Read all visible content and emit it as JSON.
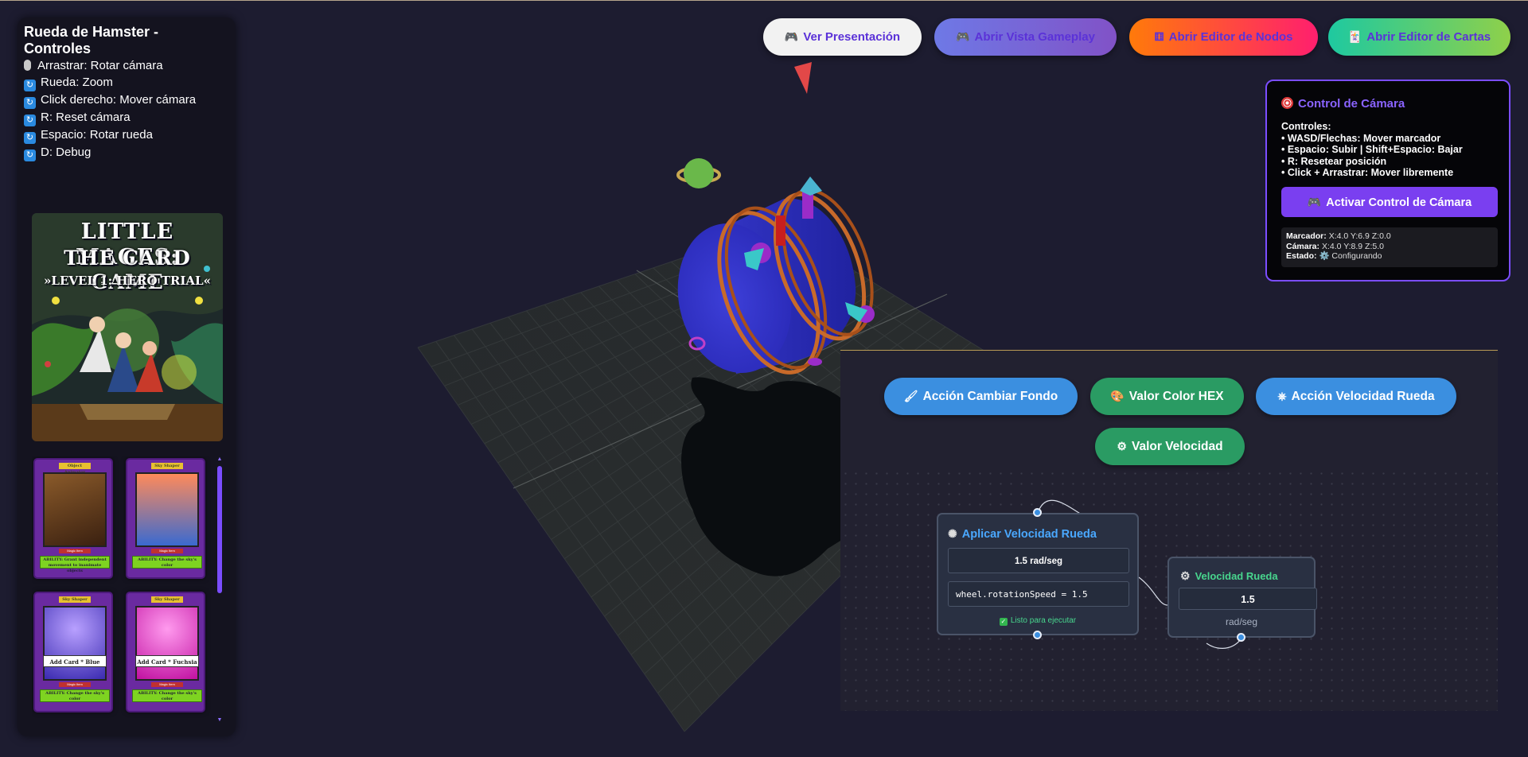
{
  "controls": {
    "title": "Rueda de Hamster - Controles",
    "lines": [
      "Arrastrar: Rotar cámara",
      "Rueda: Zoom",
      "Click derecho: Mover cámara",
      "R: Reset cámara",
      "Espacio: Rotar rueda",
      "D: Debug"
    ]
  },
  "card_art": {
    "title1": "LITTLE MAGES:",
    "title2": "THE CARD GAME",
    "title3": "»LEVEL 1: HERO TRIAL«"
  },
  "mini_cards": [
    {
      "name": "Object Animator",
      "type": "Magic Item",
      "ability": "ABILITY: Grant independent movement to inanimate objects",
      "colors": [
        "#8a5a2a",
        "#3a2010"
      ]
    },
    {
      "name": "Sky Shaper",
      "type": "Magic Item",
      "ability": "ABILITY: Change the sky's color",
      "colors": [
        "#ff8a5a",
        "#3a6ad0"
      ]
    },
    {
      "name": "Sky Shaper",
      "type": "Magic Item",
      "ability": "ABILITY: Change the sky's color",
      "banner": "Add Card * Blue",
      "colors": [
        "#b8a0ff",
        "#3a2ab0"
      ]
    },
    {
      "name": "Sky Shaper",
      "type": "Magic Item",
      "ability": "ABILITY: Change the sky's color",
      "banner": "Add Card * Fuchsia",
      "colors": [
        "#ff9aee",
        "#c010a0"
      ]
    }
  ],
  "top_buttons": {
    "present": "Ver Presentación",
    "gameplay": "Abrir Vista Gameplay",
    "nodes": "Abrir Editor de Nodos",
    "cards": "Abrir Editor de Cartas"
  },
  "camera_panel": {
    "title": "Control de Cámara",
    "controls_label": "Controles:",
    "lines": [
      "• WASD/Flechas: Mover marcador",
      "• Espacio: Subir | Shift+Espacio: Bajar",
      "• R: Resetear posición",
      "• Click + Arrastrar: Mover libremente"
    ],
    "activate": "Activar Control de Cámara",
    "marker_label": "Marcador:",
    "marker_value": "X:4.0 Y:6.9 Z:0.0",
    "camera_label": "Cámara:",
    "camera_value": "X:4.0 Y:8.9 Z:5.0",
    "state_label": "Estado:",
    "state_value": "⚙️ Configurando"
  },
  "node_palette": {
    "bg": "Acción Cambiar Fondo",
    "hex": "Valor Color HEX",
    "speed_action": "Acción Velocidad Rueda",
    "speed_value": "Valor Velocidad"
  },
  "node_apply": {
    "title": "Aplicar Velocidad Rueda",
    "speed": "1.5 rad/seg",
    "code": "wheel.rotationSpeed = 1.5",
    "ready": "Listo para ejecutar"
  },
  "node_speed": {
    "title": "Velocidad Rueda",
    "value": "1.5",
    "unit": "rad/seg"
  },
  "colors": {
    "accent": "#7b4dff",
    "background": "#1d1c30",
    "node_blue": "#3b8fe0",
    "node_green": "#2a9b63"
  }
}
